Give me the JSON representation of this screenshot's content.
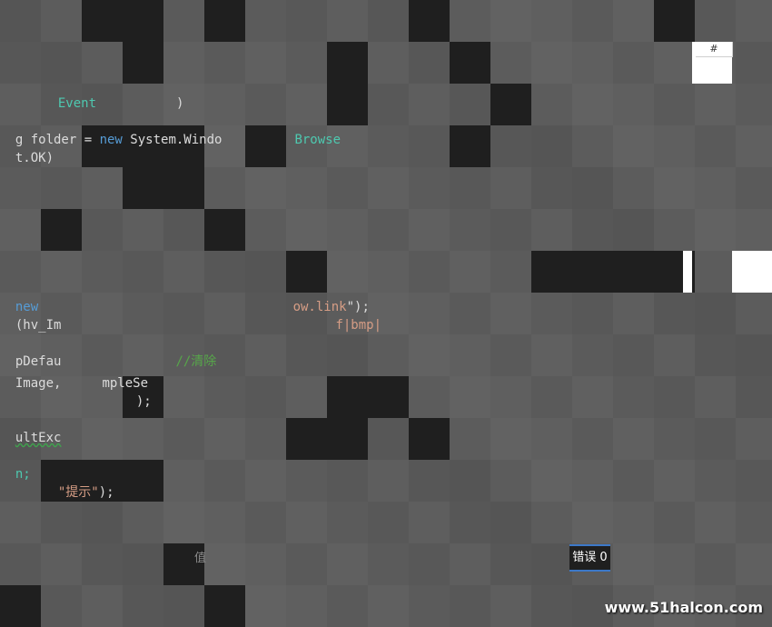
{
  "colors": {
    "background": "#5c5c5c",
    "dark_tile": "#1f1f1f",
    "keyword": "#569cd6",
    "type": "#4ec9b0",
    "string": "#d69d85",
    "comment": "#57a64a",
    "error_tab_accent": "#3c78c8"
  },
  "code": {
    "line1": {
      "a": "Event",
      "b": ")"
    },
    "line2": {
      "a": "g folder = ",
      "b": "new",
      "c": " System.Windo",
      "d": "Browse"
    },
    "line3": {
      "a": "t.OK)"
    },
    "line4": {
      "a": "new ",
      "b": "ow.link",
      "c": "\");"
    },
    "line5": {
      "a": "(hv_Im",
      "b": "f|bmp|"
    },
    "line6": {
      "a": "pDefau",
      "b": "//清除"
    },
    "line7": {
      "a": "Image,",
      "b": "mpleSe"
    },
    "line8": {
      "a": ");"
    },
    "line9": {
      "a": "ultExc"
    },
    "line10": {
      "a": "n;"
    },
    "line11": {
      "a": "\"提示\"",
      "b": ");"
    }
  },
  "grid_header": {
    "hash": "#"
  },
  "bottom_panel": {
    "faded_label": "值",
    "error_tab_label": "错误 0"
  },
  "watermark": "www.51halcon.com"
}
